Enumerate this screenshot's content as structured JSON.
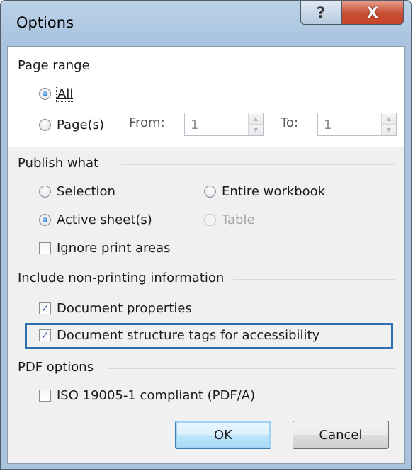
{
  "window": {
    "title": "Options",
    "help_glyph": "?",
    "close_glyph": "X"
  },
  "page_range": {
    "title": "Page range",
    "all_label": "All",
    "pages_label": "Page(s)",
    "from_label": "From:",
    "from_value": "1",
    "to_label": "To:",
    "to_value": "1",
    "selected": "All"
  },
  "publish_what": {
    "title": "Publish what",
    "selection_label": "Selection",
    "entire_workbook_label": "Entire workbook",
    "active_sheets_label": "Active sheet(s)",
    "table_label": "Table",
    "ignore_print_areas_label": "Ignore print areas",
    "selected": "Active sheet(s)",
    "ignore_print_areas_checked": false
  },
  "non_printing": {
    "title": "Include non-printing information",
    "document_properties_label": "Document properties",
    "document_properties_checked": true,
    "structure_tags_label": "Document structure tags for accessibility",
    "structure_tags_checked": true
  },
  "pdf_options": {
    "title": "PDF options",
    "iso_label": "ISO 19005-1 compliant (PDF/A)",
    "iso_checked": false
  },
  "buttons": {
    "ok": "OK",
    "cancel": "Cancel"
  },
  "colors": {
    "highlight_border": "#2e6fae",
    "title_bar": "#a9c3df",
    "close_button": "#c64e32"
  }
}
